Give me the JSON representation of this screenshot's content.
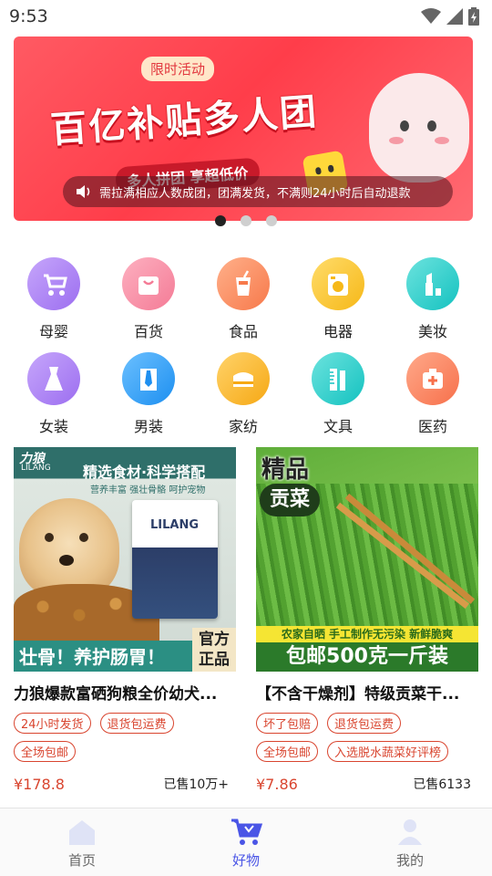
{
  "status_bar": {
    "time": "9:53"
  },
  "banner": {
    "tag": "限时活动",
    "headline": "百亿补贴多人团",
    "subtitle": "多人拼团 享超低价",
    "notice": "需拉满相应人数成团，团满发货，不满则24小时后自动退款"
  },
  "carousel": {
    "count": 3,
    "active_index": 0
  },
  "categories": [
    {
      "label": "母婴",
      "icon": "stroller-icon",
      "color": "#b28af3"
    },
    {
      "label": "百货",
      "icon": "shopping-bag-icon",
      "color": "#f98ea6"
    },
    {
      "label": "食品",
      "icon": "drink-cup-icon",
      "color": "#fb9063"
    },
    {
      "label": "电器",
      "icon": "washing-machine-icon",
      "color": "#fbc93a"
    },
    {
      "label": "美妆",
      "icon": "lipstick-icon",
      "color": "#33d3cf"
    },
    {
      "label": "女装",
      "icon": "dress-icon",
      "color": "#b28af3"
    },
    {
      "label": "男装",
      "icon": "shirt-tie-icon",
      "color": "#3aa7f5"
    },
    {
      "label": "家纺",
      "icon": "bed-icon",
      "color": "#fbba2e"
    },
    {
      "label": "文具",
      "icon": "ruler-icon",
      "color": "#33d3cf"
    },
    {
      "label": "医药",
      "icon": "medical-kit-icon",
      "color": "#fb8a6a"
    }
  ],
  "products": [
    {
      "title": "力狼爆款富硒狗粮全价幼犬...",
      "badges": [
        "24小时发货",
        "退货包运费",
        "全场包邮"
      ],
      "price": "¥178.8",
      "sold": "已售10万+",
      "image_text": {
        "brand": "力狼",
        "brand_en": "LILANG",
        "banner": "精选食材·科学搭配",
        "sub": "营养丰富  强壮骨骼  呵护宠物",
        "bottom": "壮骨！养护肠胃！",
        "official": "官方正品",
        "bag": "LILANG"
      }
    },
    {
      "title": "【不含干燥剂】特级贡菜干...",
      "badges": [
        "坏了包赔",
        "退货包运费",
        "全场包邮",
        "入选脱水蔬菜好评榜"
      ],
      "price": "¥7.86",
      "sold": "已售6133",
      "image_text": {
        "top1": "精品",
        "top2": "贡菜",
        "strip": "农家自晒 手工制作无污染 新鲜脆爽",
        "bottom": "包邮500克一斤装"
      }
    }
  ],
  "bottom_nav": [
    {
      "label": "首页",
      "icon": "home-icon",
      "active": false
    },
    {
      "label": "好物",
      "icon": "shopping-cart-icon",
      "active": true
    },
    {
      "label": "我的",
      "icon": "user-icon",
      "active": false
    }
  ],
  "colors": {
    "accent": "#4a55e6",
    "price": "#d9452f",
    "banner": "#ff4450"
  }
}
